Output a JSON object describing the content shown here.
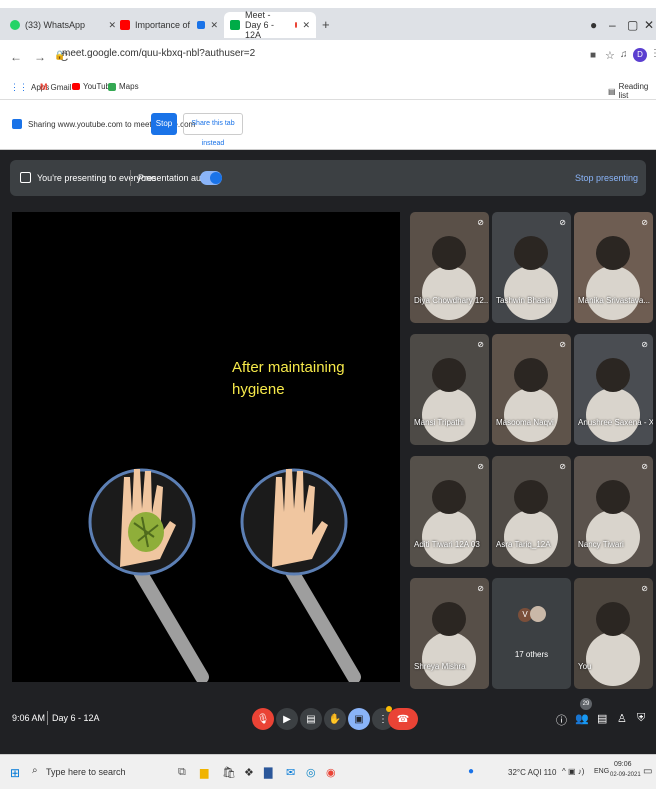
{
  "browser": {
    "tabs": [
      {
        "title": "(33) WhatsApp",
        "color": "#25d366"
      },
      {
        "title": "Importance of Hygiene. - Yo",
        "color": "#ff0000"
      },
      {
        "title": "Meet - Day 6 - 12A",
        "color": "#00ac47"
      }
    ],
    "url": "meet.google.com/quu-kbxq-nbl?authuser=2",
    "profile_initial": "D",
    "reading_list": "Reading list",
    "bookmarks": [
      "Apps",
      "Gmail",
      "YouTube",
      "Maps"
    ]
  },
  "sharing": {
    "text": "Sharing www.youtube.com to meet.google.com",
    "stop_label": "Stop",
    "share_tab_label": "Share this tab instead"
  },
  "presentation": {
    "status": "You're presenting to everyone",
    "audio_label": "Presentation audio",
    "stop_label": "Stop presenting"
  },
  "slide": {
    "title_line1": "After maintaining",
    "title_line2": "hygiene"
  },
  "participants": [
    {
      "name": "Diya Chowdhary 12..."
    },
    {
      "name": "Tashwin Bhasin"
    },
    {
      "name": "Manika Srivastava..."
    },
    {
      "name": "Mansi Tripathi"
    },
    {
      "name": "Masooma Naqvi"
    },
    {
      "name": "Anushree Saxena - XI..."
    },
    {
      "name": "Aditi Tiwari 12A 03"
    },
    {
      "name": "Asra Tariq_12A"
    },
    {
      "name": "Nancy Tiwari"
    },
    {
      "name": "Shreya Mishra"
    },
    {
      "name": "17 others",
      "initial": "V"
    },
    {
      "name": "You"
    }
  ],
  "meeting": {
    "time": "9:06 AM",
    "code": "Day 6 - 12A",
    "people_count": "29"
  },
  "taskbar": {
    "search_placeholder": "Type here to search",
    "weather": "32°C AQI 110",
    "lang": "ENG",
    "time": "09:06",
    "date": "02-09-2021"
  },
  "colors": {
    "meet_bg": "#202124",
    "accent_blue": "#1a73e8",
    "end_call_red": "#ea4335",
    "slide_text": "#f6e94a"
  }
}
